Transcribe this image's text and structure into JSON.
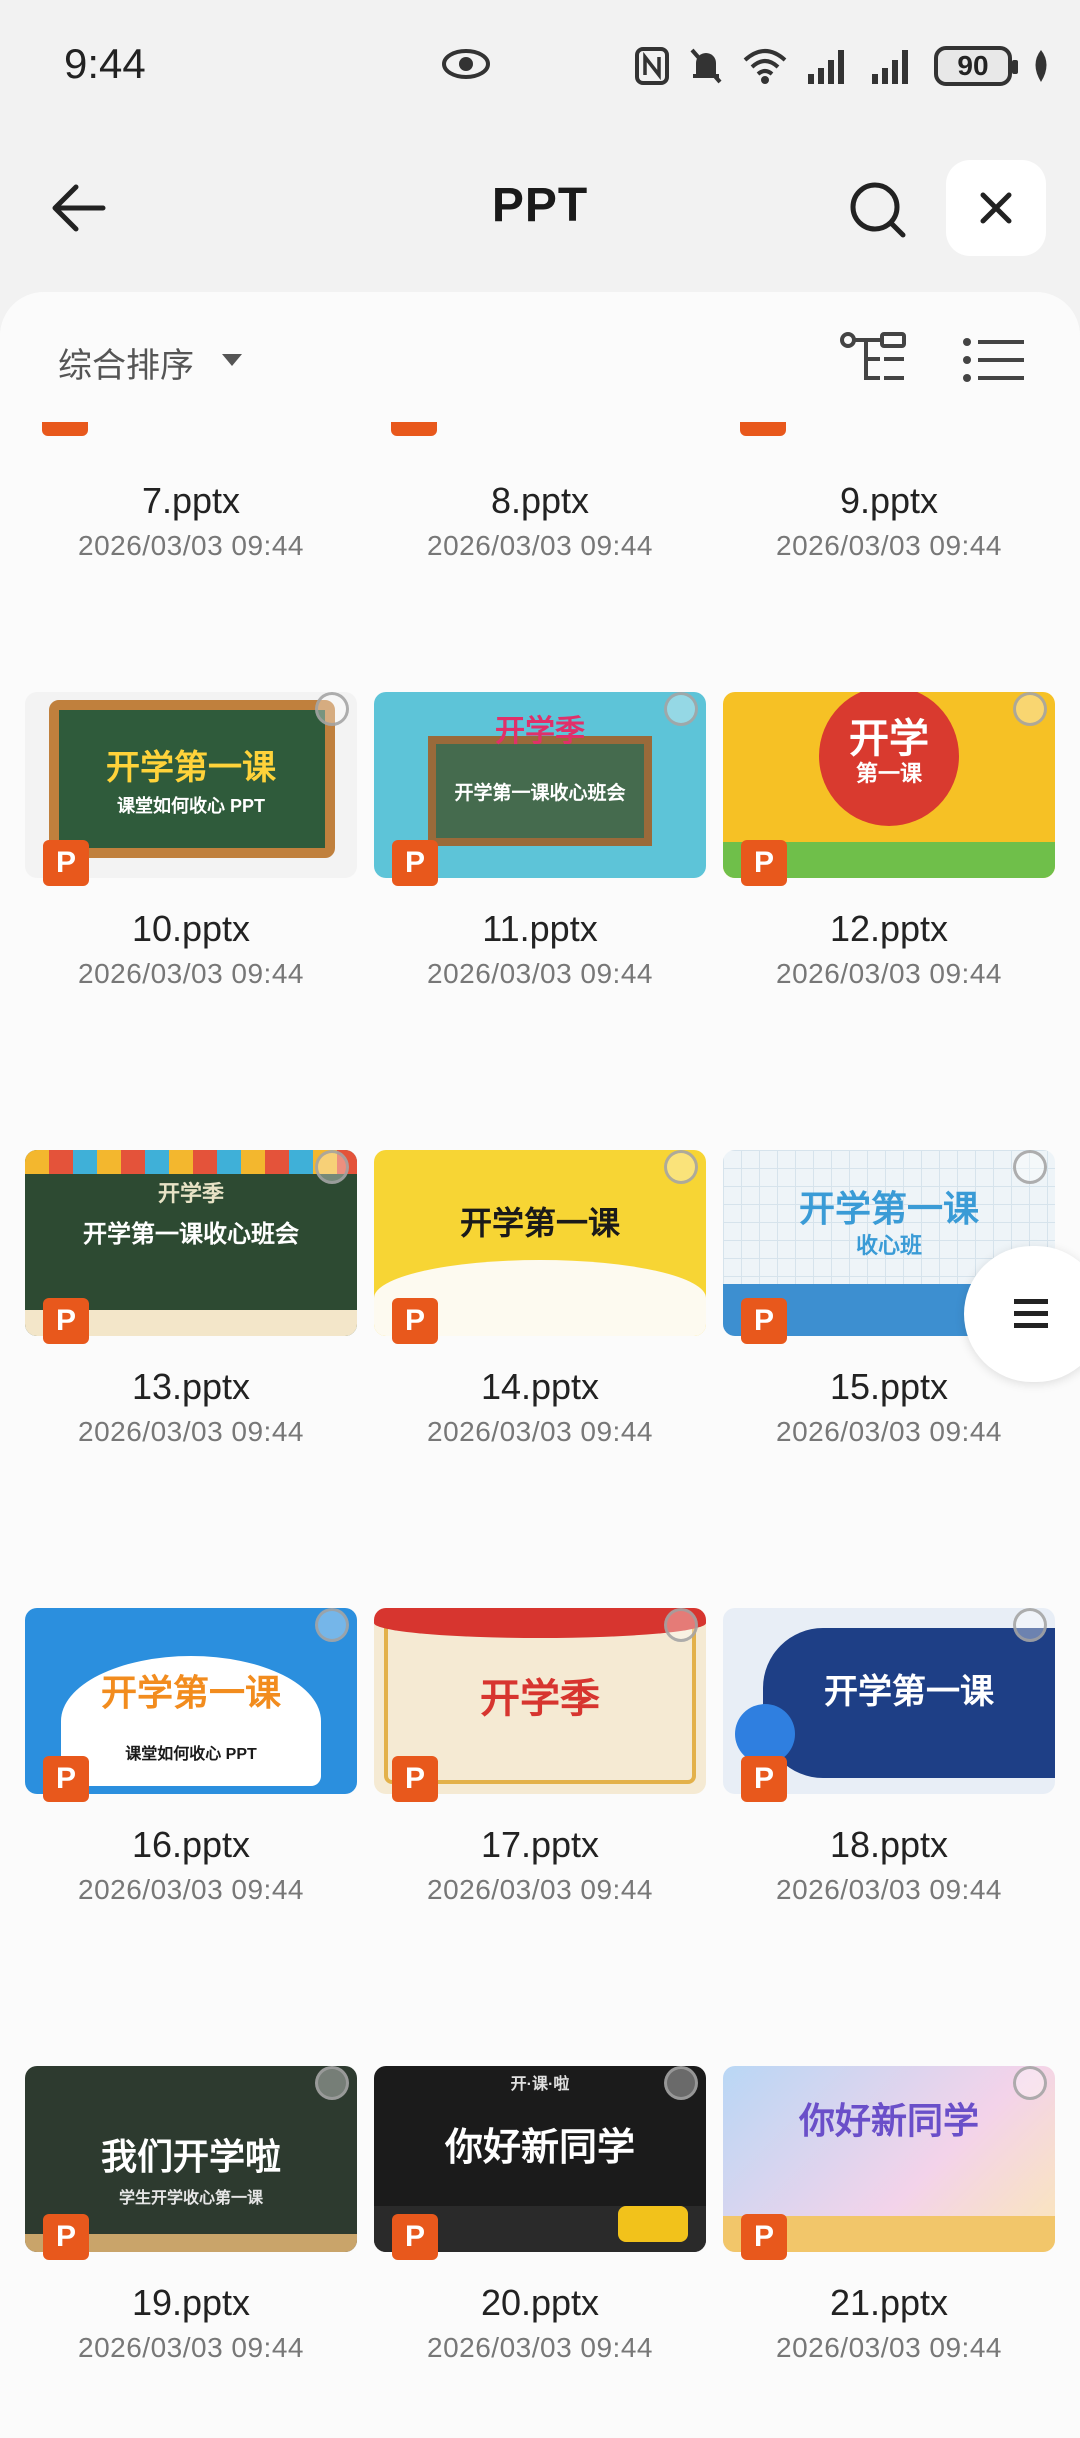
{
  "status_bar": {
    "time": "9:44",
    "battery": "90"
  },
  "header": {
    "title": "PPT"
  },
  "sort": {
    "label": "综合排序"
  },
  "colors": {
    "ppt_badge": "#e8581c"
  },
  "files": [
    {
      "name": "7.pptx",
      "date": "2026/03/03 09:44"
    },
    {
      "name": "8.pptx",
      "date": "2026/03/03 09:44"
    },
    {
      "name": "9.pptx",
      "date": "2026/03/03 09:44"
    },
    {
      "name": "10.pptx",
      "date": "2026/03/03 09:44",
      "thumb_title": "开学第一课",
      "thumb_sub": "课堂如何收心 PPT"
    },
    {
      "name": "11.pptx",
      "date": "2026/03/03 09:44",
      "thumb_title": "开学第一课收心班会",
      "thumb_sub": "开学季"
    },
    {
      "name": "12.pptx",
      "date": "2026/03/03 09:44",
      "thumb_title": "开学",
      "thumb_sub": "第一课"
    },
    {
      "name": "13.pptx",
      "date": "2026/03/03 09:44",
      "thumb_title": "开学第一课收心班会",
      "thumb_sub": "开学季"
    },
    {
      "name": "14.pptx",
      "date": "2026/03/03 09:44",
      "thumb_title": "开学第一课",
      "thumb_sub": ""
    },
    {
      "name": "15.pptx",
      "date": "2026/03/03 09:44",
      "thumb_title": "开学第一课",
      "thumb_sub": "收心班"
    },
    {
      "name": "16.pptx",
      "date": "2026/03/03 09:44",
      "thumb_title": "开学第一课",
      "thumb_sub": "课堂如何收心 PPT"
    },
    {
      "name": "17.pptx",
      "date": "2026/03/03 09:44",
      "thumb_title": "开学季",
      "thumb_sub": ""
    },
    {
      "name": "18.pptx",
      "date": "2026/03/03 09:44",
      "thumb_title": "开学第一课",
      "thumb_sub": ""
    },
    {
      "name": "19.pptx",
      "date": "2026/03/03 09:44",
      "thumb_title": "我们开学啦",
      "thumb_sub": "学生开学收心第一课"
    },
    {
      "name": "20.pptx",
      "date": "2026/03/03 09:44",
      "thumb_title": "你好新同学",
      "thumb_sub": "开·课·啦"
    },
    {
      "name": "21.pptx",
      "date": "2026/03/03 09:44",
      "thumb_title": "你好新同学",
      "thumb_sub": ""
    }
  ]
}
